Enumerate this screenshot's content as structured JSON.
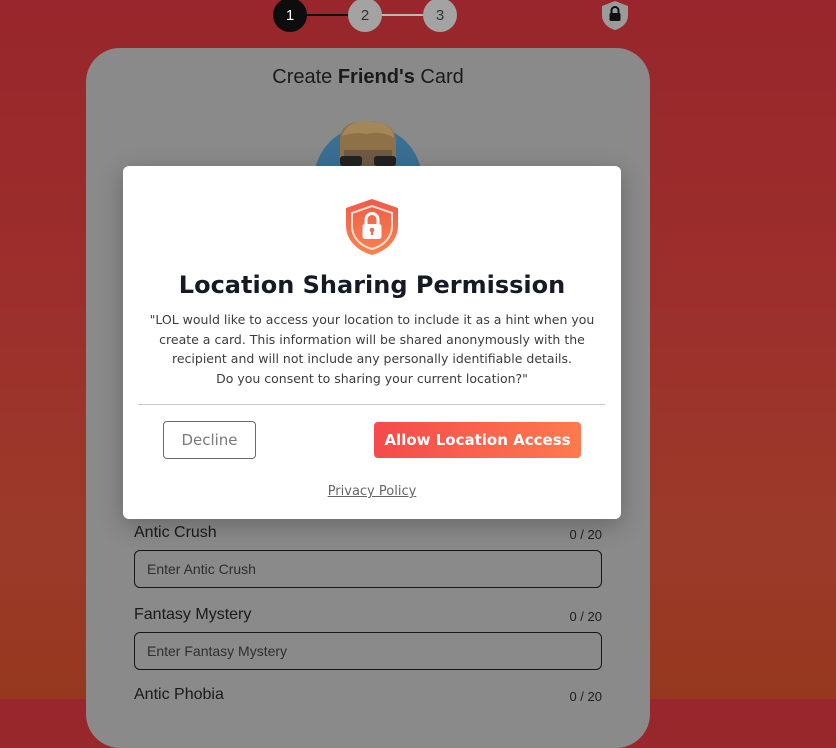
{
  "stepper": {
    "steps": [
      "1",
      "2",
      "3"
    ],
    "current_step": 1,
    "colors": {
      "active": "#0d0d0d",
      "inactive": "#a3a3a3"
    }
  },
  "header": {
    "lock_icon": "lock-shield-icon"
  },
  "card": {
    "title_prefix": "Create ",
    "title_bold": "Friend's",
    "title_suffix": " Card",
    "avatar_icon": "avatar-illustration"
  },
  "fields": [
    {
      "label": "Antic Crush",
      "count": "0 / 20",
      "placeholder": "Enter Antic Crush",
      "value": ""
    },
    {
      "label": "Fantasy Mystery",
      "count": "0 / 20",
      "placeholder": "Enter Fantasy Mystery",
      "value": ""
    },
    {
      "label": "Antic Phobia",
      "count": "0 / 20"
    }
  ],
  "modal": {
    "icon": "shield-lock-icon",
    "title": "Location Sharing Permission",
    "body": [
      "\"LOL would like to access your location to include it as a hint when you",
      "create a card. This information will be shared anonymously with the",
      "recipient and will not include any personally identifiable details.",
      "Do you consent to sharing your current location?\""
    ],
    "decline_label": "Decline",
    "allow_label": "Allow Location Access",
    "privacy_label": "Privacy Policy",
    "colors": {
      "accent_start": "#f44a4c",
      "accent_end": "#ff7a4e",
      "shield": "#f26a4f"
    }
  },
  "colors": {
    "background_top": "#98262c",
    "background_bottom": "#96381f"
  }
}
